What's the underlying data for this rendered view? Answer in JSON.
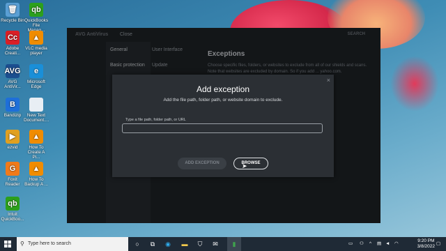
{
  "desktop": {
    "icons": [
      {
        "label": "Recycle Bin",
        "color": "#5a9fd4",
        "glyph": "🗑"
      },
      {
        "label": "QuickBooks File Manag...",
        "color": "#2ca01c",
        "glyph": "qb"
      },
      {
        "label": "Adobe Creati...",
        "color": "#da1f26",
        "glyph": "Cc"
      },
      {
        "label": "VLC media player",
        "color": "#f08c00",
        "glyph": "▲"
      },
      {
        "label": "AVG AntiVir...",
        "color": "#1b4e8f",
        "glyph": "AVG"
      },
      {
        "label": "Microsoft Edge",
        "color": "#1a8fd8",
        "glyph": "e"
      },
      {
        "label": "Bandizip",
        "color": "#1e6fd9",
        "glyph": "B"
      },
      {
        "label": "New Text Document....",
        "color": "#e8eef4",
        "glyph": ""
      },
      {
        "label": "ezvid",
        "color": "#e0a020",
        "glyph": "▶"
      },
      {
        "label": "How To Create A Pi...",
        "color": "#f08c00",
        "glyph": "▲"
      },
      {
        "label": "Foxit Reader",
        "color": "#f07a1a",
        "glyph": "G"
      },
      {
        "label": "How To Backup A ...",
        "color": "#f08c00",
        "glyph": "▲"
      },
      {
        "label": "Intuit QuickBoo...",
        "color": "#2ca01c",
        "glyph": "qb"
      }
    ]
  },
  "app": {
    "title": "AVG AntiVirus",
    "close_label": "Close",
    "search_label": "SEARCH",
    "sidebar": [
      "General",
      "Basic protection"
    ],
    "subnav": [
      "User Interface",
      "Update"
    ],
    "exceptions_title": "Exceptions",
    "exceptions_desc": "Choose specific files, folders, or websites to exclude from all of our shields and scans. Note that websites are excluded by domain. So if you add ... yahoo.com."
  },
  "modal": {
    "title": "Add exception",
    "subtitle": "Add the file path, folder path, or website domain to exclude.",
    "field_label": "Type a file path, folder path, or URL",
    "field_value": "",
    "add_button": "ADD EXCEPTION",
    "browse_button": "BROWSE",
    "close_icon": "×"
  },
  "taskbar": {
    "search_placeholder": "Type here to search",
    "time": "9:20 PM",
    "date": "3/8/2022",
    "active_app": "AVG AntiVirus"
  }
}
